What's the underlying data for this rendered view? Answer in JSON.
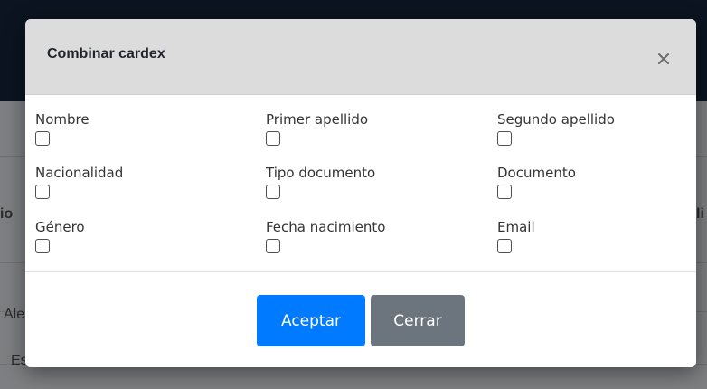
{
  "background": {
    "header_left": "io",
    "header_right": "li",
    "row1_left": "Ale",
    "row2_left": "Es"
  },
  "modal": {
    "title": "Combinar cardex",
    "close_symbol": "×",
    "fields": [
      {
        "label": "Nombre",
        "checked": false
      },
      {
        "label": "Primer apellido",
        "checked": false
      },
      {
        "label": "Segundo apellido",
        "checked": false
      },
      {
        "label": "Nacionalidad",
        "checked": false
      },
      {
        "label": "Tipo documento",
        "checked": false
      },
      {
        "label": "Documento",
        "checked": false
      },
      {
        "label": "Género",
        "checked": false
      },
      {
        "label": "Fecha nacimiento",
        "checked": false
      },
      {
        "label": "Email",
        "checked": false
      }
    ],
    "accept_label": "Aceptar",
    "close_label": "Cerrar"
  },
  "colors": {
    "primary": "#007bff",
    "secondary": "#6c757d",
    "header_bg": "#dcdcdc"
  }
}
